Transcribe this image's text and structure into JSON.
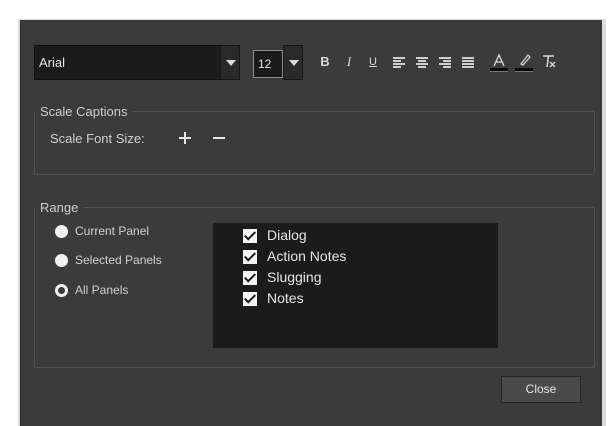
{
  "toolbar": {
    "font_family": "Arial",
    "font_size": "12",
    "bold_icon": "B",
    "italic_icon": "I",
    "underline_icon": "U"
  },
  "scale_captions": {
    "title": "Scale Captions",
    "font_size_label": "Scale Font Size:"
  },
  "range": {
    "title": "Range",
    "options": [
      {
        "label": "Current Panel",
        "selected": false
      },
      {
        "label": "Selected Panels",
        "selected": false
      },
      {
        "label": "All Panels",
        "selected": true
      }
    ],
    "caption_types": [
      {
        "label": "Dialog",
        "checked": true
      },
      {
        "label": "Action Notes",
        "checked": true
      },
      {
        "label": "Slugging",
        "checked": true
      },
      {
        "label": "Notes",
        "checked": true
      }
    ]
  },
  "footer": {
    "close_label": "Close"
  },
  "colors": {
    "dialog_bg": "#3b3b3b",
    "field_bg": "#1b1b1b",
    "text": "#d0d0d0"
  }
}
